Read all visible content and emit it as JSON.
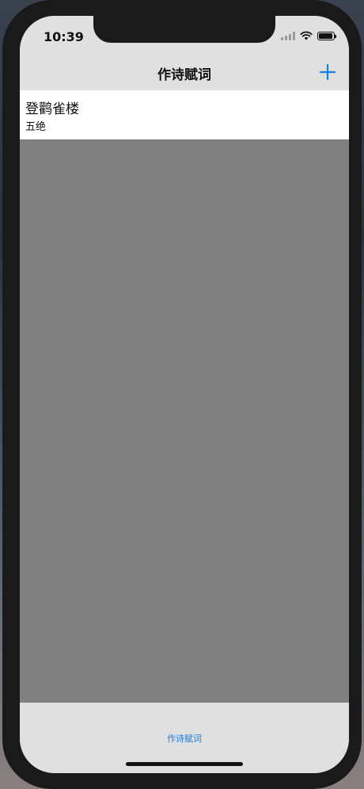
{
  "status_bar": {
    "time": "10:39",
    "icons": [
      "signal-icon",
      "wifi-icon",
      "battery-icon"
    ]
  },
  "nav_bar": {
    "title": "作诗赋词",
    "add_icon": "plus-icon"
  },
  "list": {
    "items": [
      {
        "title": "登鹳雀楼",
        "subtitle": "五绝"
      }
    ]
  },
  "tab_bar": {
    "items": [
      {
        "label": "作诗赋词",
        "selected": true
      }
    ]
  },
  "colors": {
    "accent": "#1a7fe0",
    "bar_background": "#e0e0e0",
    "content_background": "#808080",
    "cell_background": "#ffffff"
  }
}
